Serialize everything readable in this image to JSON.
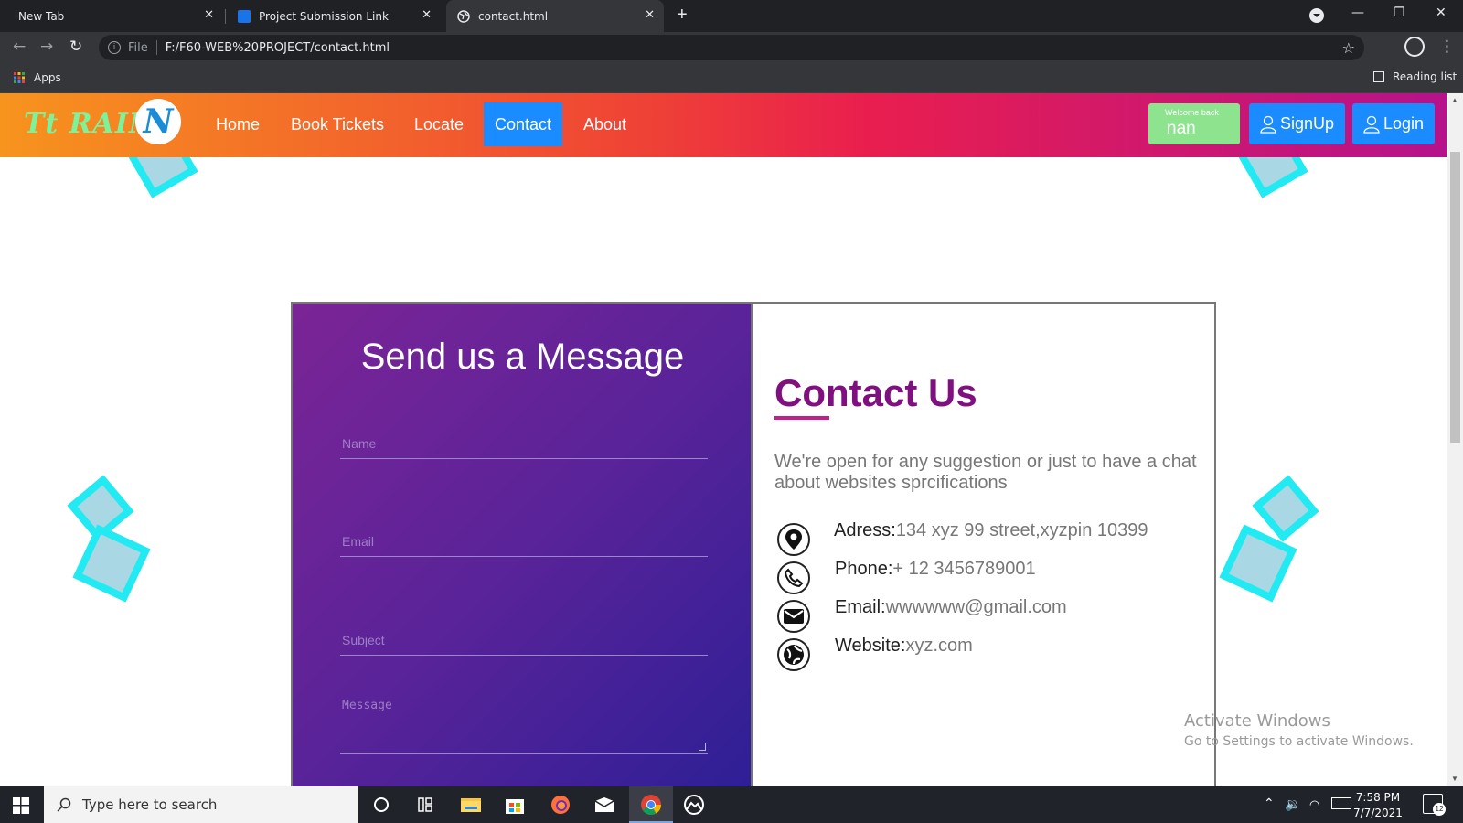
{
  "browser": {
    "tabs": [
      {
        "title": "New Tab",
        "active": false
      },
      {
        "title": "Project Submission Link",
        "active": false
      },
      {
        "title": "contact.html",
        "active": true
      }
    ],
    "url_scheme": "File",
    "url": "F:/F60-WEB%20PROJECT/contact.html",
    "bookmarks": {
      "apps": "Apps",
      "reading_list": "Reading list"
    }
  },
  "site": {
    "logo_text": "Tt RAIN",
    "logo_mark": "N",
    "nav": [
      {
        "label": "Home",
        "active": false
      },
      {
        "label": "Book Tickets",
        "active": false
      },
      {
        "label": "Locate",
        "active": false
      },
      {
        "label": "Contact",
        "active": true
      },
      {
        "label": "About",
        "active": false
      }
    ],
    "welcome_label": "Welcome back",
    "welcome_user": "nan",
    "signup_label": "SignUp",
    "login_label": "Login"
  },
  "form": {
    "title": "Send us a Message",
    "fields": [
      {
        "placeholder": "Name"
      },
      {
        "placeholder": "Email"
      },
      {
        "placeholder": "Subject"
      },
      {
        "placeholder": "Message"
      }
    ]
  },
  "contact": {
    "title": "Contact Us",
    "intro": "We're open for any suggestion or just to have a chat about websites sprcifications",
    "items": [
      {
        "label": "Adress:",
        "value": "134 xyz 99 street,xyzpin 10399",
        "icon": "location-pin-icon"
      },
      {
        "label": "Phone:",
        "value": "+ 12 3456789001",
        "icon": "phone-icon"
      },
      {
        "label": "Email:",
        "value": "wwwwww@gmail.com",
        "icon": "mail-icon"
      },
      {
        "label": "Website:",
        "value": "xyz.com",
        "icon": "globe-icon"
      }
    ]
  },
  "watermark": {
    "line1": "Activate Windows",
    "line2": "Go to Settings to activate Windows."
  },
  "taskbar": {
    "search_placeholder": "Type here to search",
    "time": "7:58 PM",
    "date": "7/7/2021",
    "notifications": "12"
  },
  "colors": {
    "nav_active": "#1a8cff",
    "contact_title": "#800f7f",
    "accent_square": "#22eaf2"
  }
}
